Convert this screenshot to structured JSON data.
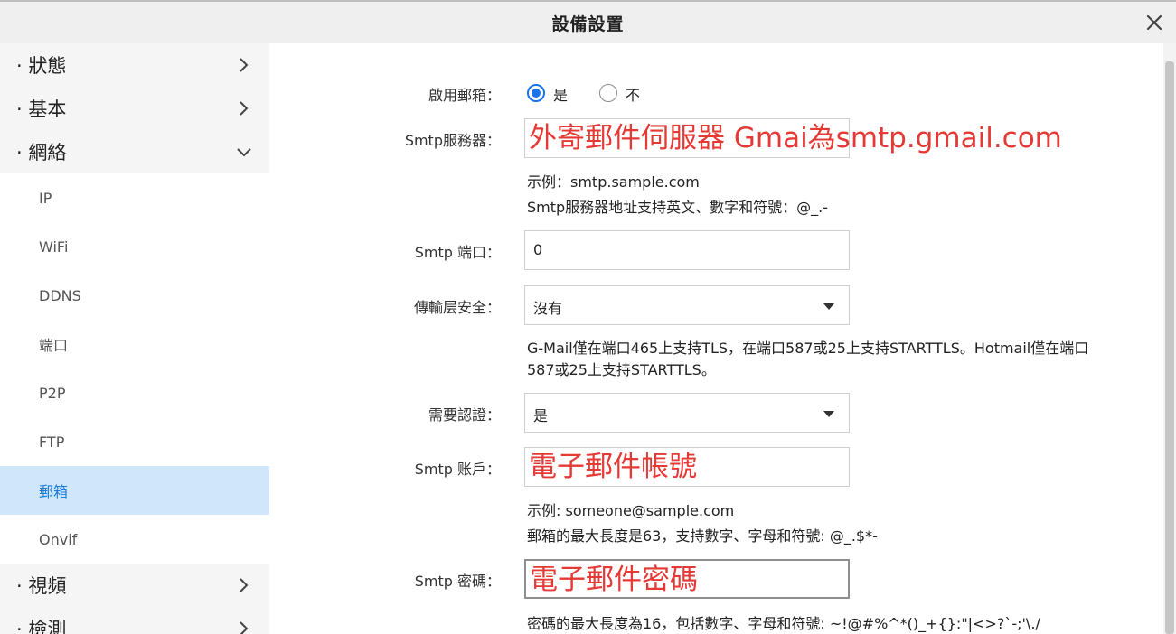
{
  "window": {
    "title": "設備設置"
  },
  "sidebar": {
    "categories_top": [
      {
        "label": "· 狀態"
      },
      {
        "label": "· 基本"
      },
      {
        "label": "· 網絡"
      }
    ],
    "sub_items": [
      {
        "label": "IP"
      },
      {
        "label": "WiFi"
      },
      {
        "label": "DDNS"
      },
      {
        "label": "端口"
      },
      {
        "label": "P2P"
      },
      {
        "label": "FTP"
      },
      {
        "label": "郵箱"
      },
      {
        "label": "Onvif"
      }
    ],
    "categories_bottom": [
      {
        "label": "· 視頻"
      },
      {
        "label": "· 檢測"
      }
    ]
  },
  "form": {
    "enable_mail": {
      "label": "啟用郵箱：",
      "option_yes": "是",
      "option_no": "不"
    },
    "smtp_server": {
      "label": "Smtp服務器：",
      "overlay": "外寄郵件伺服器 Gmai為smtp.gmail.com",
      "hint1": "示例：smtp.sample.com",
      "hint2": "Smtp服務器地址支持英文、數字和符號：@_.-"
    },
    "smtp_port": {
      "label": "Smtp 端口：",
      "value": "0"
    },
    "tls": {
      "label": "傳輸层安全：",
      "value": "沒有",
      "hint1": "G-Mail僅在端口465上支持TLS，在端口587或25上支持STARTTLS。Hotmail僅在端口",
      "hint2": "587或25上支持STARTTLS。"
    },
    "auth": {
      "label": "需要認證：",
      "value": "是"
    },
    "smtp_account": {
      "label": "Smtp 账戶：",
      "overlay": "電子郵件帳號",
      "hint1": "示例: someone@sample.com",
      "hint2": "郵箱的最大長度是63，支持數字、字母和符號: @_.$*-"
    },
    "smtp_password": {
      "label": "Smtp 密碼：",
      "overlay": "電子郵件密碼",
      "hint1": "密碼的最大長度為16，包括數字、字母和符號: ~!@#%^*()_+{}:\"|<>?`-;'\\./"
    }
  }
}
